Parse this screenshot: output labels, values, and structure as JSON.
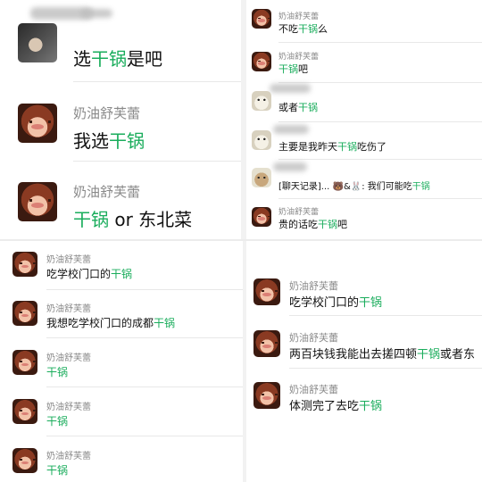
{
  "colors": {
    "highlight": "#1aad5c",
    "name": "#8a8a8a",
    "text": "#111111"
  },
  "panel_top_left": {
    "messages": [
      {
        "name": "",
        "before": "选",
        "hl": "干锅",
        "after": "是吧",
        "avatar": "dark-photo"
      },
      {
        "name": "奶油舒芙蕾",
        "before": "我选",
        "hl": "干锅",
        "after": "",
        "avatar": "woman-photo"
      },
      {
        "name": "奶油舒芙蕾",
        "before": "",
        "hl": "干锅",
        "after": " or 东北菜",
        "avatar": "woman-photo"
      }
    ]
  },
  "panel_top_right": {
    "messages": [
      {
        "name": "奶油舒芙蕾",
        "before": "不吃",
        "hl": "干锅",
        "after": "么",
        "avatar": "woman-photo"
      },
      {
        "name": "奶油舒芙蕾",
        "before": "",
        "hl": "干锅",
        "after": "吧",
        "avatar": "woman-photo"
      },
      {
        "name": "",
        "before": "或者",
        "hl": "干锅",
        "after": "",
        "avatar": "cat-photo"
      },
      {
        "name": "",
        "before": "主要是我昨天",
        "hl": "干锅",
        "after": "吃伤了",
        "avatar": "cat-photo"
      },
      {
        "name": "",
        "before": "[聊天记录]... 🐻&🐰: 我们可能吃",
        "hl": "干锅",
        "after": "",
        "avatar": "bear-photo"
      },
      {
        "name": "奶油舒芙蕾",
        "before": "贵的话吃",
        "hl": "干锅",
        "after": "吧",
        "avatar": "woman-photo"
      }
    ]
  },
  "panel_bottom_left": {
    "messages": [
      {
        "name": "奶油舒芙蕾",
        "before": "吃学校门口的",
        "hl": "干锅",
        "after": "",
        "avatar": "woman-photo"
      },
      {
        "name": "奶油舒芙蕾",
        "before": "我想吃学校门口的成都",
        "hl": "干锅",
        "after": "",
        "avatar": "woman-photo"
      },
      {
        "name": "奶油舒芙蕾",
        "before": "",
        "hl": "干锅",
        "after": "",
        "avatar": "woman-photo"
      },
      {
        "name": "奶油舒芙蕾",
        "before": "",
        "hl": "干锅",
        "after": "",
        "avatar": "woman-photo"
      },
      {
        "name": "奶油舒芙蕾",
        "before": "",
        "hl": "干锅",
        "after": "",
        "avatar": "woman-photo"
      }
    ]
  },
  "panel_bottom_right": {
    "messages": [
      {
        "name": "奶油舒芙蕾",
        "before": "吃学校门口的",
        "hl": "干锅",
        "after": "",
        "avatar": "woman-photo"
      },
      {
        "name": "奶油舒芙蕾",
        "before": "两百块钱我能出去搓四顿",
        "hl": "干锅",
        "after": "或者东",
        "avatar": "woman-photo"
      },
      {
        "name": "奶油舒芙蕾",
        "before": "体测完了去吃",
        "hl": "干锅",
        "after": "",
        "avatar": "woman-photo"
      }
    ]
  }
}
